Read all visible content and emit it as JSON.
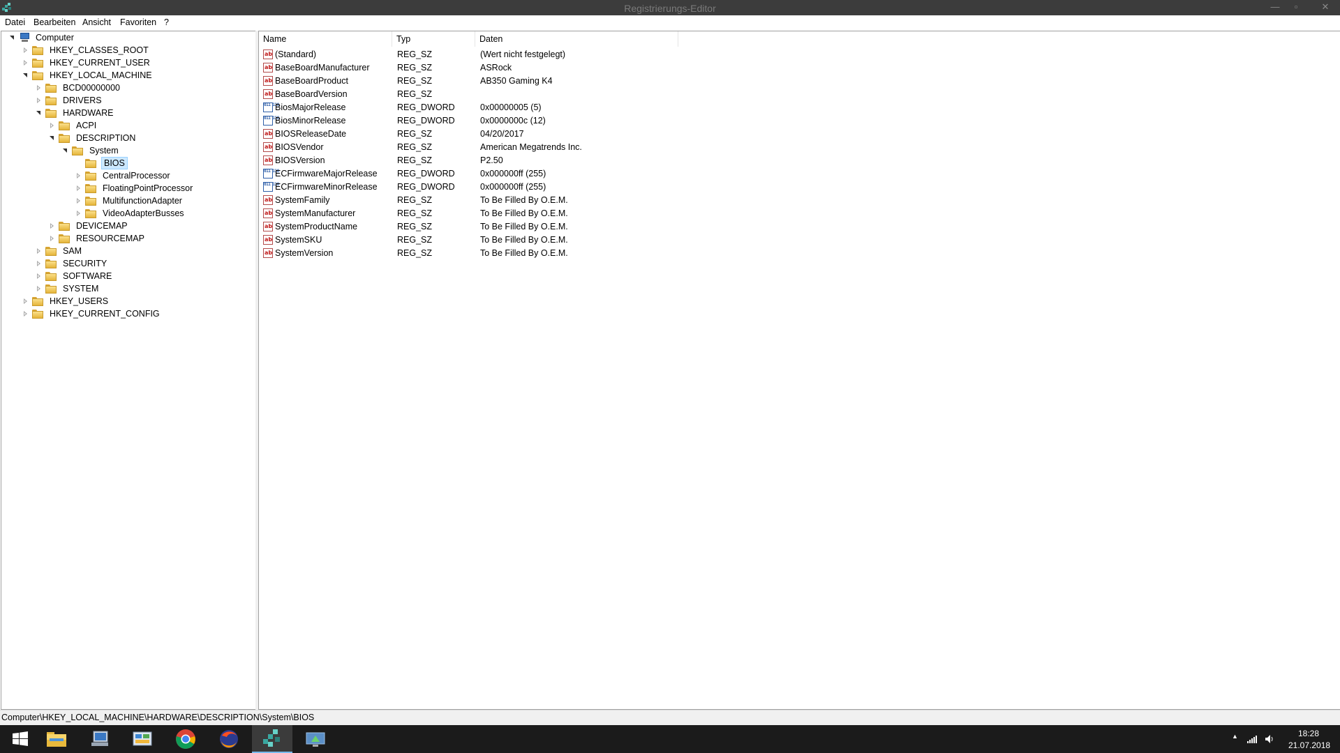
{
  "window": {
    "title": "Registrierungs-Editor",
    "min_glyph": "—",
    "max_glyph": "▫",
    "close_glyph": "✕"
  },
  "menu": [
    "Datei",
    "Bearbeiten",
    "Ansicht",
    "Favoriten",
    "?"
  ],
  "tree": [
    {
      "label": "Computer",
      "state": "expanded",
      "icon": "computer-icon"
    },
    {
      "label": "HKEY_CLASSES_ROOT",
      "state": "collapsed"
    },
    {
      "label": "HKEY_CURRENT_USER",
      "state": "collapsed"
    },
    {
      "label": "HKEY_LOCAL_MACHINE",
      "state": "expanded"
    },
    {
      "label": "BCD00000000",
      "state": "collapsed"
    },
    {
      "label": "DRIVERS",
      "state": "collapsed"
    },
    {
      "label": "HARDWARE",
      "state": "expanded"
    },
    {
      "label": "ACPI",
      "state": "collapsed"
    },
    {
      "label": "DESCRIPTION",
      "state": "expanded"
    },
    {
      "label": "System",
      "state": "expanded"
    },
    {
      "label": "BIOS",
      "state": "leaf",
      "selected": true
    },
    {
      "label": "CentralProcessor",
      "state": "collapsed"
    },
    {
      "label": "FloatingPointProcessor",
      "state": "collapsed"
    },
    {
      "label": "MultifunctionAdapter",
      "state": "collapsed"
    },
    {
      "label": "VideoAdapterBusses",
      "state": "collapsed"
    },
    {
      "label": "DEVICEMAP",
      "state": "collapsed"
    },
    {
      "label": "RESOURCEMAP",
      "state": "collapsed"
    },
    {
      "label": "SAM",
      "state": "collapsed"
    },
    {
      "label": "SECURITY",
      "state": "collapsed"
    },
    {
      "label": "SOFTWARE",
      "state": "collapsed"
    },
    {
      "label": "SYSTEM",
      "state": "collapsed"
    },
    {
      "label": "HKEY_USERS",
      "state": "collapsed"
    },
    {
      "label": "HKEY_CURRENT_CONFIG",
      "state": "collapsed"
    }
  ],
  "columns": {
    "name": "Name",
    "type": "Typ",
    "data": "Daten"
  },
  "values": [
    {
      "name": "(Standard)",
      "type": "REG_SZ",
      "data": "(Wert nicht festgelegt)",
      "icon": "string-value-icon"
    },
    {
      "name": "BaseBoardManufacturer",
      "type": "REG_SZ",
      "data": "ASRock",
      "icon": "string-value-icon"
    },
    {
      "name": "BaseBoardProduct",
      "type": "REG_SZ",
      "data": "AB350 Gaming K4",
      "icon": "string-value-icon"
    },
    {
      "name": "BaseBoardVersion",
      "type": "REG_SZ",
      "data": "",
      "icon": "string-value-icon"
    },
    {
      "name": "BiosMajorRelease",
      "type": "REG_DWORD",
      "data": "0x00000005 (5)",
      "icon": "dword-value-icon"
    },
    {
      "name": "BiosMinorRelease",
      "type": "REG_DWORD",
      "data": "0x0000000c (12)",
      "icon": "dword-value-icon"
    },
    {
      "name": "BIOSReleaseDate",
      "type": "REG_SZ",
      "data": "04/20/2017",
      "icon": "string-value-icon"
    },
    {
      "name": "BIOSVendor",
      "type": "REG_SZ",
      "data": "American Megatrends Inc.",
      "icon": "string-value-icon"
    },
    {
      "name": "BIOSVersion",
      "type": "REG_SZ",
      "data": "P2.50",
      "icon": "string-value-icon"
    },
    {
      "name": "ECFirmwareMajorRelease",
      "type": "REG_DWORD",
      "data": "0x000000ff (255)",
      "icon": "dword-value-icon"
    },
    {
      "name": "ECFirmwareMinorRelease",
      "type": "REG_DWORD",
      "data": "0x000000ff (255)",
      "icon": "dword-value-icon"
    },
    {
      "name": "SystemFamily",
      "type": "REG_SZ",
      "data": "To Be Filled By O.E.M.",
      "icon": "string-value-icon"
    },
    {
      "name": "SystemManufacturer",
      "type": "REG_SZ",
      "data": "To Be Filled By O.E.M.",
      "icon": "string-value-icon"
    },
    {
      "name": "SystemProductName",
      "type": "REG_SZ",
      "data": "To Be Filled By O.E.M.",
      "icon": "string-value-icon"
    },
    {
      "name": "SystemSKU",
      "type": "REG_SZ",
      "data": "To Be Filled By O.E.M.",
      "icon": "string-value-icon"
    },
    {
      "name": "SystemVersion",
      "type": "REG_SZ",
      "data": "To Be Filled By O.E.M.",
      "icon": "string-value-icon"
    }
  ],
  "icon_glyphs": {
    "string": "ab",
    "dword": "011 110"
  },
  "statusbar": {
    "path": "Computer\\HKEY_LOCAL_MACHINE\\HARDWARE\\DESCRIPTION\\System\\BIOS"
  },
  "taskbar": {
    "apps": [
      {
        "name": "start-button",
        "icon": "windows-logo-icon"
      },
      {
        "name": "file-explorer",
        "icon": "folder-icon"
      },
      {
        "name": "this-pc",
        "icon": "computer-icon"
      },
      {
        "name": "control-panel",
        "icon": "control-panel-icon"
      },
      {
        "name": "chrome",
        "icon": "chrome-icon"
      },
      {
        "name": "firefox",
        "icon": "firefox-icon"
      },
      {
        "name": "regedit",
        "icon": "regedit-icon",
        "active": true
      },
      {
        "name": "network",
        "icon": "network-icon"
      }
    ],
    "tray_chevron": "▲",
    "time": "18:28",
    "date": "21.07.2018"
  },
  "colors": {
    "selection": "#cce8ff",
    "taskbar": "#1b1b1b",
    "titlebar": "#3c3c3c"
  }
}
